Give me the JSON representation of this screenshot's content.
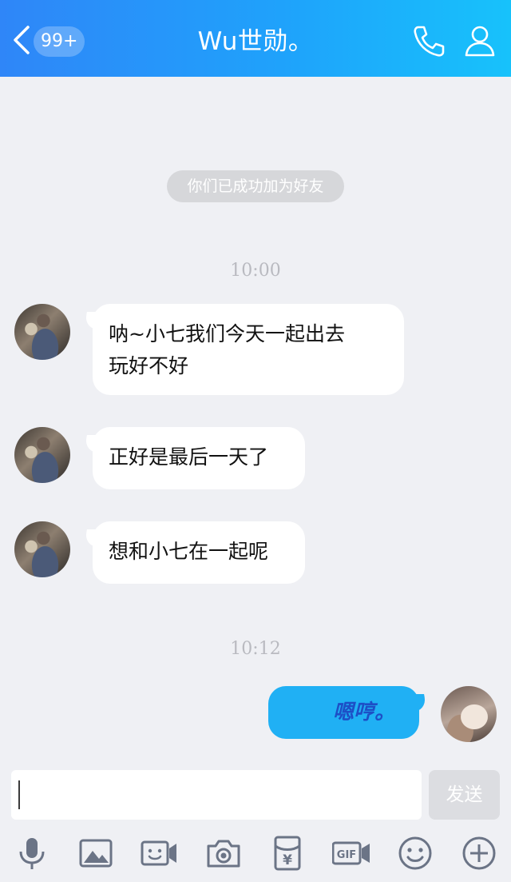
{
  "header": {
    "back_icon": "chevron-left-icon",
    "badge": "99+",
    "title": "Wu世勋。",
    "phone_icon": "phone-icon",
    "profile_icon": "person-icon"
  },
  "notices": {
    "friend_added": "你们已成功加为好友"
  },
  "timestamps": [
    "10:00",
    "10:12"
  ],
  "messages": [
    {
      "from": "contact",
      "line1": "呐~小七我们今天一起出去",
      "line2": "玩好不好"
    },
    {
      "from": "contact",
      "text": "正好是最后一天了"
    },
    {
      "from": "contact",
      "text": "想和小七在一起呢"
    },
    {
      "from": "me",
      "text": "嗯哼。"
    }
  ],
  "composer": {
    "value": "",
    "send_label": "发送"
  },
  "toolbar": {
    "icons": [
      "microphone-icon",
      "image-icon",
      "video-call-icon",
      "camera-icon",
      "red-packet-icon",
      "gif-icon",
      "emoji-icon",
      "plus-icon"
    ],
    "red_packet_symbol": "¥",
    "gif_label": "GIF"
  },
  "colors": {
    "header_start": "#2f86f8",
    "header_end": "#17c2fb",
    "my_bubble": "#20b0f4",
    "my_text": "#1d4fc6",
    "background": "#eff0f4",
    "icon": "#6b7486"
  }
}
